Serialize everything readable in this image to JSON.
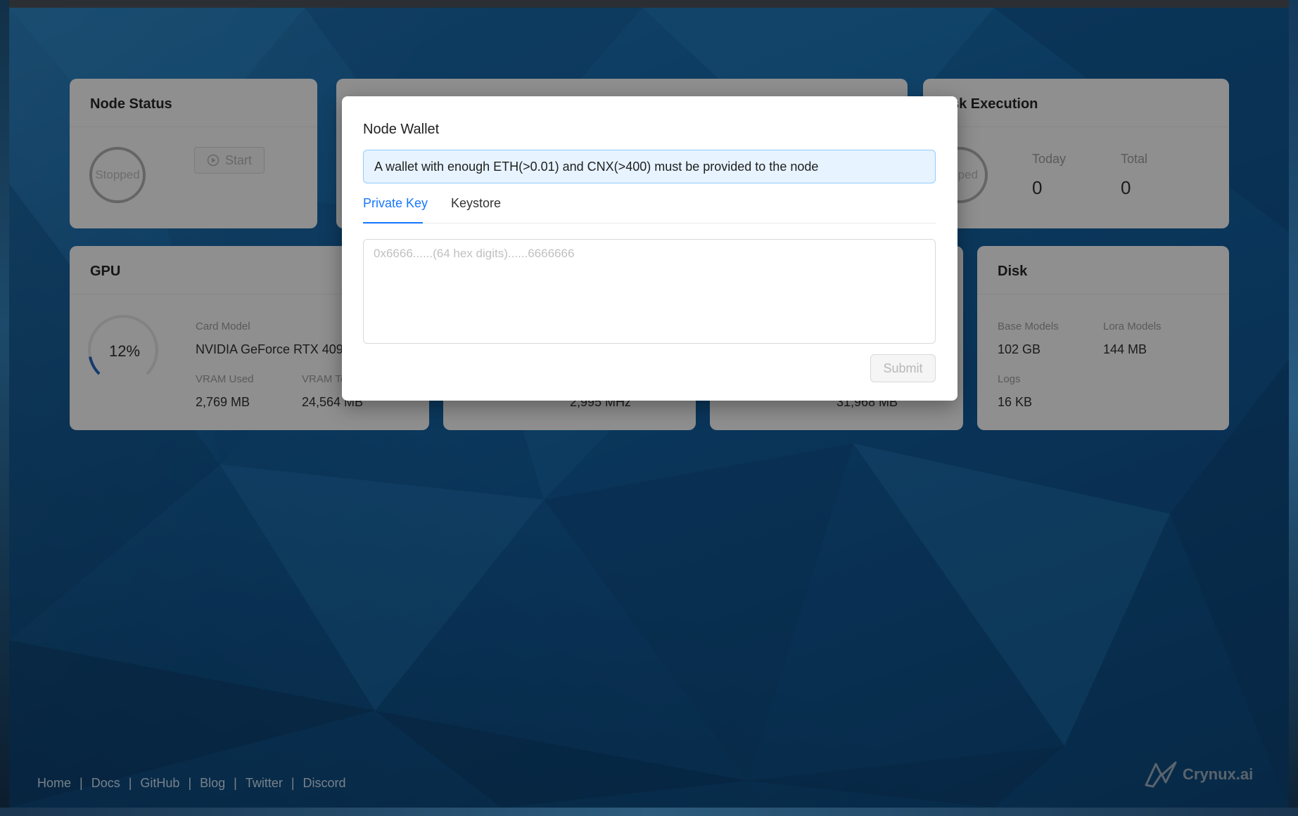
{
  "node_status": {
    "title": "Node Status",
    "state": "Stopped",
    "start_label": "Start"
  },
  "task_execution": {
    "title_visible": "sk Execution",
    "state_visible": "topped",
    "today_label": "Today",
    "today_value": "0",
    "total_label": "Total",
    "total_value": "0"
  },
  "gpu": {
    "title": "GPU",
    "usage": "12%",
    "card_model_label": "Card Model",
    "card_model": "NVIDIA GeForce RTX 4090",
    "vram_used_label": "VRAM Used",
    "vram_used": "2,769 MB",
    "vram_total_label_visible": "VRAM To",
    "vram_total": "24,564 MB"
  },
  "cpu": {
    "frequency_visible": "2,995 MHz"
  },
  "memory": {
    "total_visible": "31,968 MB"
  },
  "disk": {
    "title": "Disk",
    "base_models_label": "Base Models",
    "base_models": "102 GB",
    "lora_models_label": "Lora Models",
    "lora_models": "144 MB",
    "logs_label": "Logs",
    "logs": "16 KB"
  },
  "modal": {
    "title": "Node Wallet",
    "alert": "A wallet with enough ETH(>0.01) and CNX(>400) must be provided to the node",
    "tabs": [
      "Private Key",
      "Keystore"
    ],
    "active_tab": "Private Key",
    "placeholder": "0x6666......(64 hex digits)......6666666",
    "submit_label": "Submit"
  },
  "footer": {
    "links": [
      "Home",
      "Docs",
      "GitHub",
      "Blog",
      "Twitter",
      "Discord"
    ],
    "separator": "|"
  },
  "brand": {
    "name": "Crynux.ai"
  },
  "colors": {
    "accent": "#1677ff",
    "alert_bg": "#e7f3ff",
    "alert_border": "#91caff",
    "gpu_arc": "#1e5aa8"
  }
}
